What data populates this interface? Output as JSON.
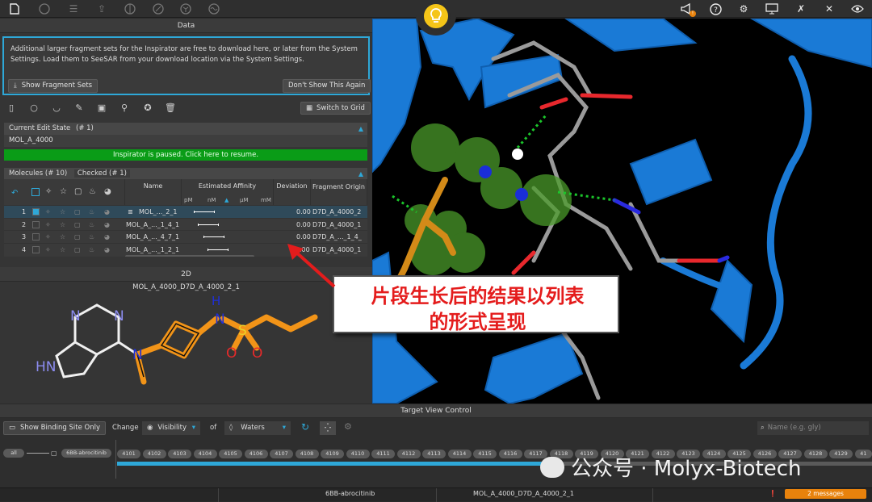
{
  "toolbar": {
    "left_icons": [
      "file-icon",
      "pdb-icon",
      "sliders-icon",
      "upload-icon",
      "molecule-icon",
      "link-icon",
      "cube-icon",
      "wave-icon"
    ],
    "right_icons": [
      "megaphone-icon",
      "help-icon",
      "gear-icon",
      "monitor-icon",
      "tools-icon",
      "wrench-icon",
      "eye-icon"
    ],
    "warning_badge": "!"
  },
  "data_panel": {
    "title": "Data",
    "notice_text": "Additional larger fragment sets for the Inspirator are free to download here, or later from the System Settings. Load them to SeeSAR from your download location via the System Settings.",
    "show_fragment_sets": "Show Fragment Sets",
    "dont_show_again": "Don't Show This Again",
    "switch_to_grid": "Switch to Grid"
  },
  "edit_state": {
    "header": "Current Edit State",
    "count": "(# 1)",
    "value": "MOL_A_4000",
    "paused_message": "Inspirator is paused. Click here to resume."
  },
  "molecules": {
    "tab_molecules": "Molecules (# 10)",
    "tab_checked": "Checked (# 1)",
    "col_name": "Name",
    "col_affinity": "Estimated Affinity",
    "affinity_units": [
      "pM",
      "nM",
      "μM",
      "mM"
    ],
    "col_deviation": "Deviation",
    "col_origin": "Fragment Origin",
    "rows": [
      {
        "num": "1",
        "name": "MOL_..._2_1",
        "deviation": "0.00",
        "origin": "D7D_A_4000_2",
        "checked": true
      },
      {
        "num": "2",
        "name": "MOL_A_..._1_4_1",
        "deviation": "0.00",
        "origin": "D7D_A_4000_1",
        "checked": false
      },
      {
        "num": "3",
        "name": "MOL_A_..._4_7_1",
        "deviation": "0.00",
        "origin": "D7D_A_..._1_4_",
        "checked": false
      },
      {
        "num": "4",
        "name": "MOL_A_..._1_2_1",
        "deviation": ".00",
        "origin": "D7D_A_4000_1",
        "checked": false
      }
    ]
  },
  "two_d": {
    "title": "2D",
    "molecule_name": "MOL_A_4000_D7D_A_4000_2_1",
    "atoms": [
      "N",
      "N",
      "HN",
      "N",
      "N",
      "H",
      "S",
      "O",
      "O"
    ]
  },
  "annotation": {
    "line1": "片段生长后的结果以列表",
    "line2": "的形式呈现"
  },
  "target_view": {
    "title": "Target View Control",
    "show_binding_site": "Show Binding Site Only",
    "change": "Change",
    "visibility": "Visibility",
    "of": "of",
    "waters": "Waters",
    "search_placeholder": "Name (e.g. gly)",
    "chain_all": "all",
    "chain_ligand": "6BB-abrocitinib",
    "residues": [
      "4101",
      "4102",
      "4103",
      "4104",
      "4105",
      "4106",
      "4107",
      "4108",
      "4109",
      "4110",
      "4111",
      "4112",
      "4113",
      "4114",
      "4115",
      "4116",
      "4117",
      "4118",
      "4119",
      "4120",
      "4121",
      "4122",
      "4123",
      "4124",
      "4125",
      "4126",
      "4127",
      "4128",
      "4129",
      "41"
    ]
  },
  "status": {
    "ligand": "6BB-abrocitinib",
    "molecule": "MOL_A_4000_D7D_A_4000_2_1",
    "messages": "2 messages"
  },
  "watermark": "公众号 · Molyx-Biotech"
}
